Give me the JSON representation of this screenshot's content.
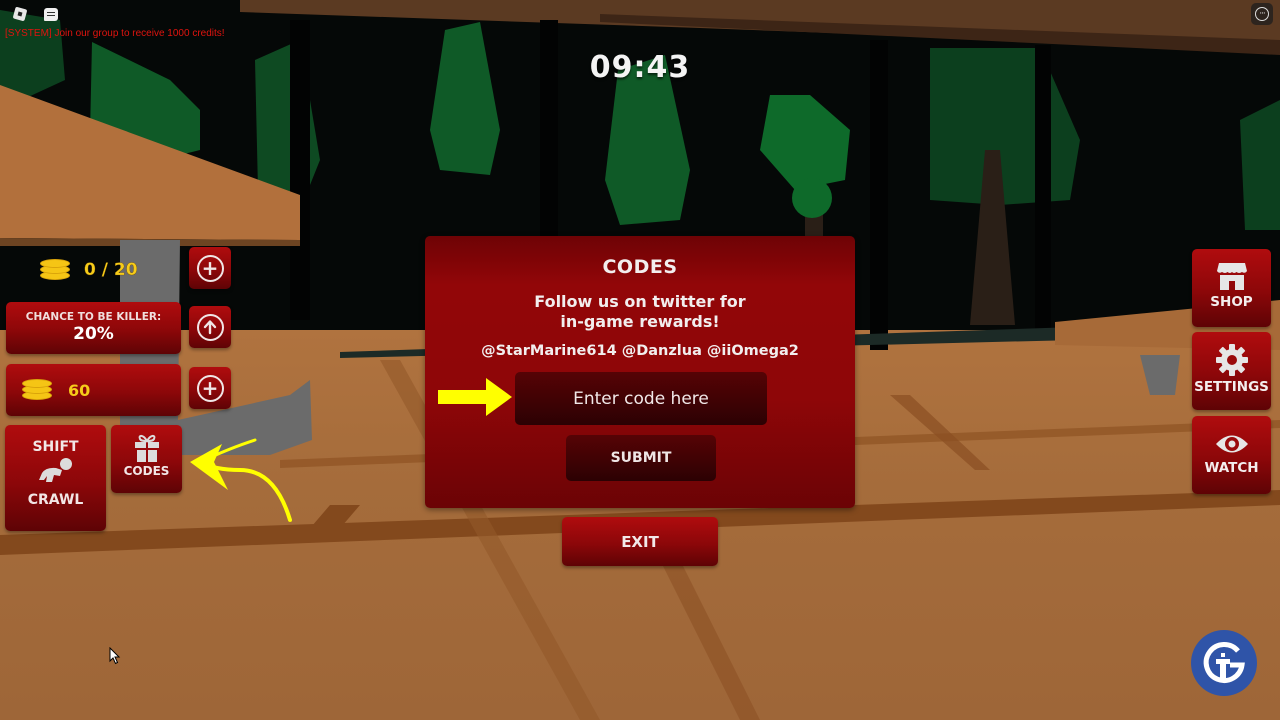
{
  "topbar": {
    "roblox_menu_icon": "roblox-logo-icon",
    "chat_icon": "chat-bubble-icon",
    "more_icon": "more-options-icon",
    "system_message": "[SYSTEM] Join our group to receive 1000 credits!"
  },
  "timer": "09:43",
  "hud_left": {
    "tokens": {
      "icon": "coin-stack-icon",
      "value": "0 / 20",
      "add_icon": "plus-circle-icon"
    },
    "killer_chance": {
      "label": "CHANCE TO BE KILLER:",
      "value": "20%",
      "upgrade_icon": "arrow-up-circle-icon"
    },
    "coins": {
      "icon": "coin-stack-icon",
      "value": "60",
      "add_icon": "plus-circle-icon"
    },
    "crawl": {
      "top_label": "SHIFT",
      "bottom_label": "CRAWL",
      "icon": "crawling-figure-icon"
    },
    "codes": {
      "label": "CODES",
      "icon": "gift-icon"
    }
  },
  "hud_right": [
    {
      "label": "SHOP",
      "icon": "storefront-icon"
    },
    {
      "label": "SETTINGS",
      "icon": "gear-icon"
    },
    {
      "label": "WATCH",
      "icon": "eye-icon"
    }
  ],
  "codes_panel": {
    "title": "CODES",
    "subtitle_line1": "Follow us on twitter for",
    "subtitle_line2": "in-game rewards!",
    "handles": "@StarMarine614 @Danzlua @iiOmega2",
    "input_placeholder": "Enter code here",
    "input_value": "",
    "submit_label": "SUBMIT"
  },
  "exit_label": "EXIT",
  "colors": {
    "button_red": "#a00a0c",
    "panel_red": "#8e0608",
    "dark_red": "#3d0204",
    "coin_yellow": "#f6cc1a",
    "system_text": "#e0140f",
    "annotation_yellow": "#ffff00",
    "logo_blue": "#2f54a8"
  },
  "watermark_logo": "gamer-tweak-logo"
}
